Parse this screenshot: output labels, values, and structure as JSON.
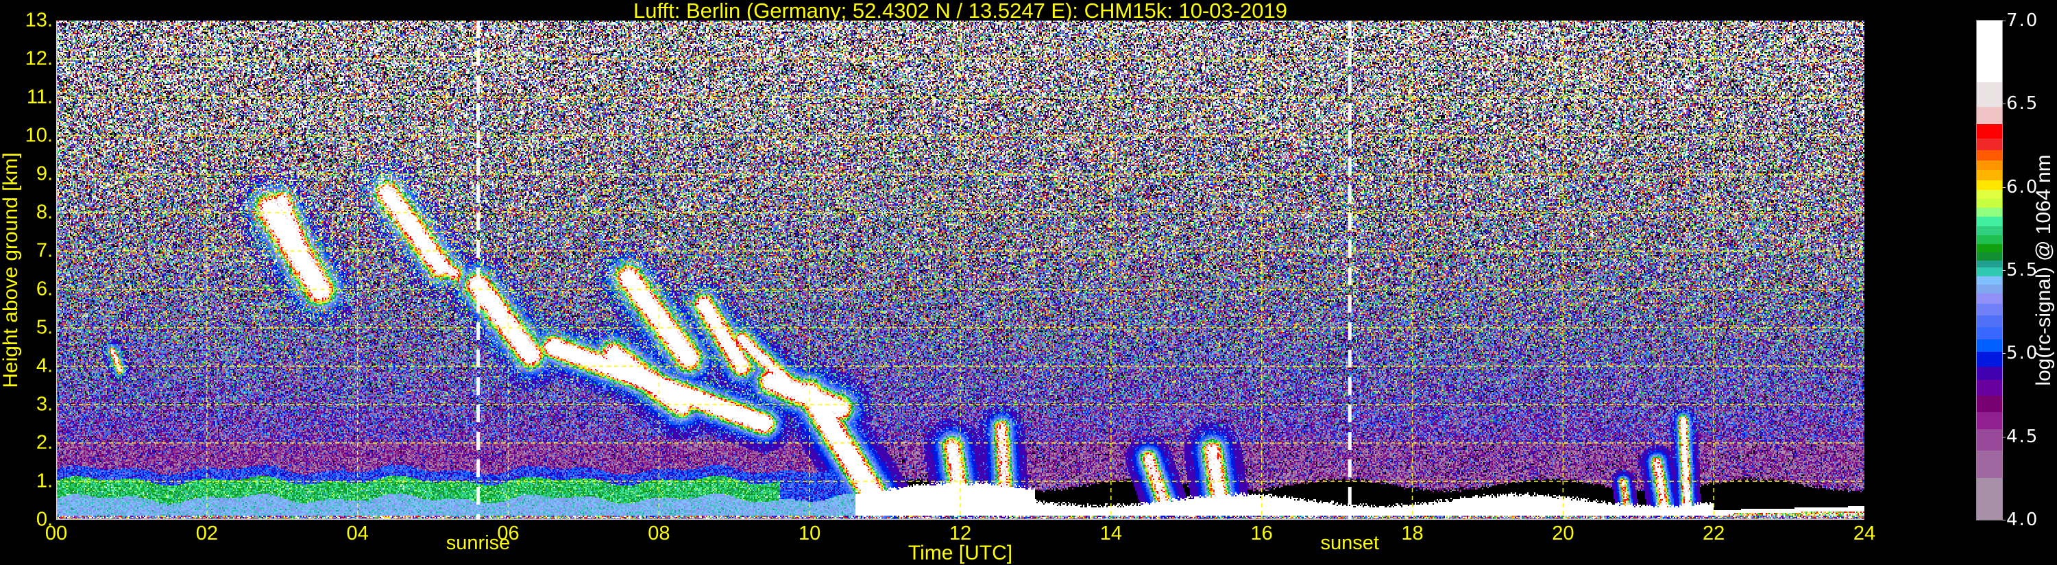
{
  "chart_data": {
    "type": "heatmap",
    "title": "Lufft: Berlin (Germany; 52.4302 N / 13.5247 E):    CHM15k: 10-03-2019",
    "xlabel": "Time [UTC]",
    "ylabel": "Height above ground [km]",
    "xlim": [
      0,
      24
    ],
    "ylim": [
      0,
      13
    ],
    "x_ticks": [
      "00",
      "02",
      "04",
      "06",
      "08",
      "10",
      "12",
      "14",
      "16",
      "18",
      "20",
      "22",
      "24"
    ],
    "x_tick_values": [
      0,
      2,
      4,
      6,
      8,
      10,
      12,
      14,
      16,
      18,
      20,
      22,
      24
    ],
    "y_ticks": [
      "0.",
      "1.",
      "2.",
      "3.",
      "4.",
      "5.",
      "6.",
      "7.",
      "8.",
      "9.",
      "10.",
      "11.",
      "12.",
      "13."
    ],
    "y_tick_values": [
      0,
      1,
      2,
      3,
      4,
      5,
      6,
      7,
      8,
      9,
      10,
      11,
      12,
      13
    ],
    "grid": true,
    "annotations": [
      {
        "label": "sunrise",
        "time": 5.6
      },
      {
        "label": "sunset",
        "time": 17.17
      }
    ],
    "colorbar": {
      "label": "log(rc-signal) @ 1064 nm",
      "range": [
        4.0,
        7.0
      ],
      "ticks": [
        "4.0",
        "4.5",
        "5.0",
        "5.5",
        "6.0",
        "6.5",
        "7.0"
      ],
      "tick_values": [
        4.0,
        4.5,
        5.0,
        5.5,
        6.0,
        6.5,
        7.0
      ],
      "levels": [
        4.0,
        4.253,
        4.417,
        4.547,
        4.651,
        4.746,
        4.841,
        4.923,
        5.01,
        5.087,
        5.161,
        5.232,
        5.301,
        5.362,
        5.414,
        5.466,
        5.517,
        5.561,
        5.61,
        5.658,
        5.712,
        5.766,
        5.822,
        5.876,
        5.93,
        5.984,
        6.043,
        6.103,
        6.161,
        6.222,
        6.295,
        6.378,
        6.481,
        6.633,
        7.0
      ],
      "colors": [
        "#a890a8",
        "#a068a0",
        "#984898",
        "#902090",
        "#780070",
        "#6800a0",
        "#4000b0",
        "#0018e0",
        "#0060ff",
        "#3868ff",
        "#5070f8",
        "#7080f8",
        "#9090f8",
        "#80a8f0",
        "#80c0ff",
        "#30c8b0",
        "#20a090",
        "#109030",
        "#10a010",
        "#20c050",
        "#30d080",
        "#40f0a0",
        "#90ff80",
        "#c8ff40",
        "#e0ff40",
        "#ffe600",
        "#ffb400",
        "#ff9600",
        "#ff5a00",
        "#f02828",
        "#ff0000",
        "#f0c4c4",
        "#ebe3e3",
        "#ffffff"
      ]
    },
    "cloud_features": [
      [
        2.85,
        8.1,
        3.5,
        6.0,
        0.35,
        1.0
      ],
      [
        3.0,
        8.3,
        3.3,
        6.8,
        0.25,
        0.8
      ],
      [
        4.4,
        8.5,
        5.1,
        6.6,
        0.3,
        0.9
      ],
      [
        4.9,
        6.9,
        5.3,
        6.4,
        0.2,
        0.7
      ],
      [
        5.6,
        6.1,
        6.3,
        4.3,
        0.3,
        1.0
      ],
      [
        6.6,
        4.5,
        9.4,
        2.5,
        0.25,
        1.1
      ],
      [
        7.4,
        4.3,
        8.3,
        3.0,
        0.3,
        1.0
      ],
      [
        7.6,
        6.3,
        8.4,
        4.2,
        0.3,
        1.0
      ],
      [
        8.6,
        5.6,
        9.1,
        4.0,
        0.25,
        0.9
      ],
      [
        9.1,
        4.7,
        9.7,
        3.6,
        0.2,
        0.8
      ],
      [
        9.5,
        3.6,
        10.4,
        2.9,
        0.3,
        1.0
      ],
      [
        10.0,
        3.3,
        10.9,
        0.5,
        0.3,
        1.1
      ],
      [
        0.75,
        4.4,
        0.85,
        3.9,
        0.1,
        0.7
      ],
      [
        11.9,
        1.9,
        12.0,
        0.6,
        0.25,
        0.8
      ],
      [
        12.55,
        2.4,
        12.6,
        0.6,
        0.2,
        0.7
      ],
      [
        14.5,
        1.6,
        14.7,
        0.5,
        0.2,
        0.7
      ],
      [
        15.35,
        1.8,
        15.45,
        0.5,
        0.25,
        0.8
      ],
      [
        21.25,
        1.5,
        21.35,
        0.3,
        0.15,
        0.7
      ],
      [
        21.6,
        2.6,
        21.65,
        0.3,
        0.12,
        0.8
      ],
      [
        20.8,
        1.0,
        20.85,
        0.3,
        0.1,
        0.6
      ]
    ],
    "text_color": "#ffff00",
    "grid_color": "#ffff00"
  }
}
